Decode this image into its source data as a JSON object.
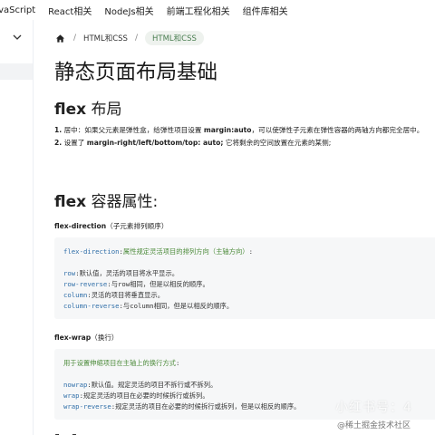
{
  "topnav": {
    "items": [
      "JavaScript",
      "React相关",
      "NodeJs相关",
      "前端工程化相关",
      "组件库相关"
    ]
  },
  "breadcrumb": {
    "home_icon": "home-icon",
    "items": [
      "HTML和CSS",
      "HTML和CSS"
    ]
  },
  "page": {
    "title": "静态页面布局基础"
  },
  "section_flex": {
    "heading_en": "flex",
    "heading_cjk": " 布局",
    "list": [
      {
        "num": "1.",
        "before": " 居中：如果父元素是弹性盒，给弹性项目设置 ",
        "bold": "margin:auto",
        "after": "，可以使弹性子元素在弹性容器的两轴方向都完全居中。"
      },
      {
        "num": "2.",
        "before": " 设置了 ",
        "bold": "margin-right/left/bottom/top: auto;",
        "after": " 它将剩余的空间放置在元素的某侧;"
      }
    ]
  },
  "section_props": {
    "heading_en": "flex",
    "heading_cjk": " 容器属性:",
    "flex_direction": {
      "label_en": "flex-direction",
      "label_cjk": "（子元素排列顺序）",
      "lines": [
        [
          {
            "c": "k",
            "t": "flex-direction"
          },
          {
            "c": "t",
            "t": ":"
          },
          {
            "c": "g",
            "t": "属性规定灵活项目的排列方向（主轴方向）"
          },
          {
            "c": "t",
            "t": ":"
          }
        ],
        [],
        [
          {
            "c": "k",
            "t": "row"
          },
          {
            "c": "t",
            "t": ":默认值，灵活的项目将水平显示。"
          }
        ],
        [
          {
            "c": "k",
            "t": "row-reverse"
          },
          {
            "c": "t",
            "t": ":与row相同，但是以相反的顺序。"
          }
        ],
        [
          {
            "c": "k",
            "t": "column"
          },
          {
            "c": "t",
            "t": ":灵活的项目将垂直显示。"
          }
        ],
        [
          {
            "c": "k",
            "t": "column-reverse"
          },
          {
            "c": "t",
            "t": ":与column相同，但是以相反的顺序。"
          }
        ]
      ]
    },
    "flex_wrap": {
      "label_en": "flex-wrap",
      "label_cjk": "（换行）",
      "lines": [
        [
          {
            "c": "g",
            "t": "用于设置伸缩项目在主轴上的换行方式"
          },
          {
            "c": "t",
            "t": ":"
          }
        ],
        [],
        [
          {
            "c": "k",
            "t": "nowrap"
          },
          {
            "c": "t",
            "t": ":默认值。规定灵活的项目不拆行或不拆列。"
          }
        ],
        [
          {
            "c": "k",
            "t": "wrap"
          },
          {
            "c": "t",
            "t": ":规定灵活的项目在必要的时候拆行或拆列。"
          }
        ],
        [
          {
            "c": "k",
            "t": "wrap-reverse"
          },
          {
            "c": "t",
            "t": ":规定灵活的项目在必要的时候拆行或拆列，但是以相反的顺序。"
          }
        ]
      ]
    },
    "flex_flow": {
      "label_en": "flex-flow"
    }
  },
  "watermark": {
    "line1": "小红书号：4",
    "line2": "@稀土掘金技术社区"
  },
  "colors": {
    "keyword": "#2f6ea8",
    "green": "#4c8b3a",
    "breadcrumb_current": "#4b7f52",
    "code_bg": "#f6f7f8"
  }
}
